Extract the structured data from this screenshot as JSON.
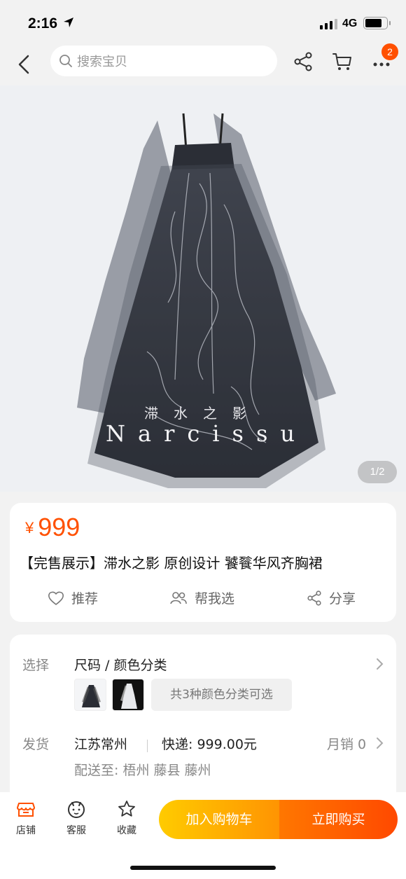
{
  "status_bar": {
    "time": "2:16",
    "network": "4G"
  },
  "nav": {
    "search_placeholder": "搜索宝贝",
    "cart_badge": "2"
  },
  "hero": {
    "image_counter": "1/2",
    "overlay_title_cn": "滞水之影",
    "overlay_title_en": "Narcissu"
  },
  "product": {
    "currency": "¥",
    "price": "999",
    "title": "【完售展示】滞水之影 原创设计 饕餮华风齐胸裙",
    "actions": {
      "recommend": "推荐",
      "help_choose": "帮我选",
      "share": "分享"
    }
  },
  "options": {
    "select_label": "选择",
    "select_value": "尺码 / 颜色分类",
    "color_count_tag": "共3种颜色分类可选",
    "ship_label": "发货",
    "ship_from": "江苏常州",
    "express": "快递: 999.00元",
    "monthly_sales": "月销 0",
    "deliver_to": "配送至: 梧州 藤县 藤州"
  },
  "bottom_bar": {
    "shop": "店铺",
    "service": "客服",
    "favorite": "收藏",
    "add_to_cart": "加入购物车",
    "buy_now": "立即购买"
  },
  "colors": {
    "accent": "#ff5000",
    "cart_gradient": [
      "#ffcb00",
      "#ff9402"
    ],
    "buy_gradient": [
      "#ff7700",
      "#ff4900"
    ]
  }
}
